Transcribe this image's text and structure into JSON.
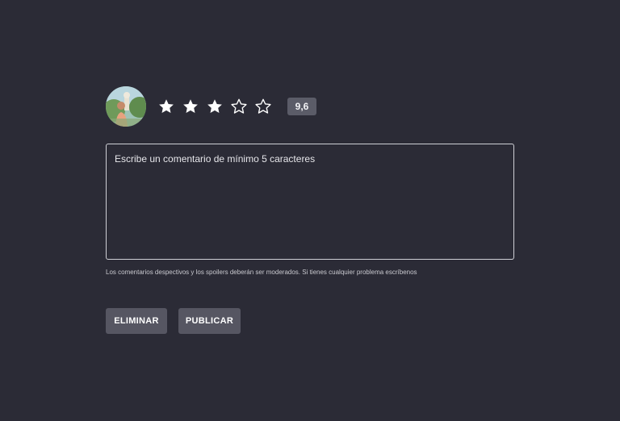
{
  "review": {
    "avatar_icon": "user-avatar-photo",
    "rating": {
      "stars_total": 5,
      "stars_filled": 3,
      "filled_icon": "star-filled-icon",
      "empty_icon": "star-outline-icon",
      "score": "9,6"
    },
    "comment": {
      "placeholder": "Escribe un comentario de mínimo 5 caracteres",
      "value": ""
    },
    "moderation_note": "Los comentarios despectivos y los spoilers deberán ser moderados. Si tienes cualquier problema escríbenos",
    "actions": {
      "delete_label": "ELIMINAR",
      "publish_label": "PUBLICAR"
    }
  },
  "colors": {
    "background": "#2b2b36",
    "button": "#565662",
    "badge": "#5b5c68",
    "text": "#ffffff"
  }
}
